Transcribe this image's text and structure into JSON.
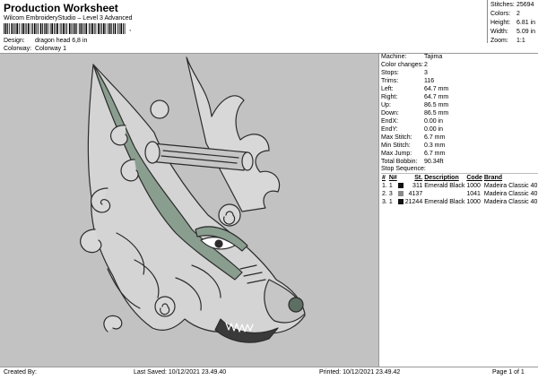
{
  "header": {
    "title": "Production Worksheet",
    "subtitle": "Wilcom EmbroideryStudio – Level 3 Advanced",
    "barcode_suffix": ",",
    "design_label": "Design:",
    "design_value": "dragon head 6,8 in",
    "colorway_label": "Colorway:",
    "colorway_value": "Colorway 1"
  },
  "stats": [
    {
      "label": "Stitches:",
      "value": "25694"
    },
    {
      "label": "Colors:",
      "value": "2"
    },
    {
      "label": "Height:",
      "value": "6.81 in"
    },
    {
      "label": "Width:",
      "value": "5.09 in"
    },
    {
      "label": "Zoom:",
      "value": "1:1"
    }
  ],
  "machine_info": [
    {
      "label": "Machine:",
      "value": "Tajima"
    },
    {
      "label": "Color changes:",
      "value": "2"
    },
    {
      "label": "Stops:",
      "value": "3"
    },
    {
      "label": "Trims:",
      "value": "116"
    },
    {
      "label": "Left:",
      "value": "64.7 mm"
    },
    {
      "label": "Right:",
      "value": "64.7 mm"
    },
    {
      "label": "Up:",
      "value": "86.5 mm"
    },
    {
      "label": "Down:",
      "value": "86.5 mm"
    },
    {
      "label": "EndX:",
      "value": "0.00 in"
    },
    {
      "label": "EndY:",
      "value": "0.00 in"
    },
    {
      "label": "Max Stitch:",
      "value": "6.7 mm"
    },
    {
      "label": "Min Stitch:",
      "value": "0.3 mm"
    },
    {
      "label": "Max Jump:",
      "value": "6.7 mm"
    },
    {
      "label": "Total Bobbin:",
      "value": "90.34ft"
    }
  ],
  "stop_sequence": {
    "title": "Stop Sequence:",
    "columns": [
      "#",
      "N#",
      "St.",
      "Description",
      "Code",
      "Brand"
    ],
    "rows": [
      {
        "idx": "1.",
        "n": "1",
        "color": "#111111",
        "st": "311",
        "desc": "Emerald Black",
        "code": "1000",
        "brand": "Madeira Classic 40"
      },
      {
        "idx": "2.",
        "n": "3",
        "color": "#8a8a8a",
        "st": "4137",
        "desc": "",
        "code": "1041",
        "brand": "Madeira Classic 40"
      },
      {
        "idx": "3.",
        "n": "1",
        "color": "#111111",
        "st": "21244",
        "desc": "Emerald Black",
        "code": "1000",
        "brand": "Madeira Classic 40"
      }
    ]
  },
  "footer": {
    "created_by": "Created By:",
    "last_saved": "Last Saved: 10/12/2021 23.49.40",
    "printed": "Printed: 10/12/2021 23.49.42",
    "page": "Page 1 of 1"
  },
  "colors": {
    "preview_bg": "#c2c2c2",
    "fill_light": "#d8d8d8",
    "accent_green": "#8a9e8f",
    "outline": "#2b2b2b"
  }
}
